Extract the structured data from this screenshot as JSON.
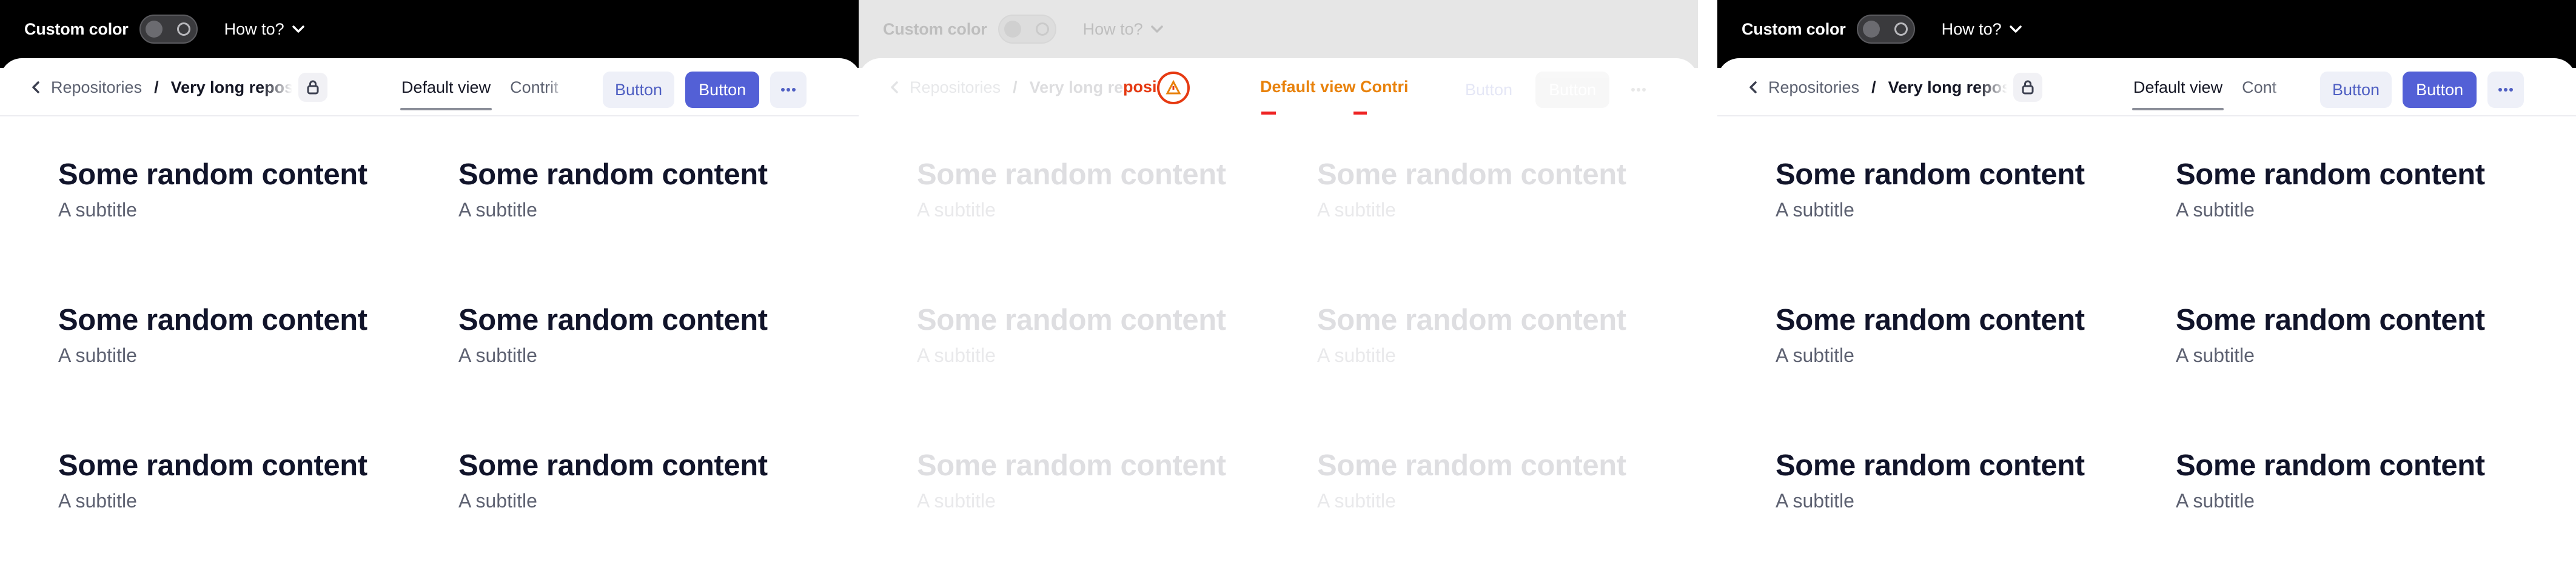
{
  "topbar": {
    "custom_color_label": "Custom color",
    "howto_label": "How to?"
  },
  "breadcrumb": {
    "back": "Repositories",
    "separator": "/",
    "current": "Very long repository name"
  },
  "tabs": {
    "default_view": "Default view",
    "contributors_truncated_1": "Contrit",
    "contributors_truncated_3": "Cont"
  },
  "actions": {
    "secondary_label": "Button",
    "primary_label": "Button"
  },
  "content": {
    "items": [
      {
        "title": "Some random content",
        "subtitle": "A subtitle"
      },
      {
        "title": "Some random content",
        "subtitle": "A subtitle"
      },
      {
        "title": "Some random content",
        "subtitle": "A subtitle"
      },
      {
        "title": "Some random content",
        "subtitle": "A subtitle"
      },
      {
        "title": "Some random content",
        "subtitle": "A subtitle"
      },
      {
        "title": "Some random content",
        "subtitle": "A subtitle"
      }
    ]
  },
  "overlay": {
    "glitch_fragment": "posi",
    "glitch_tabs_text": "Default view Contri"
  },
  "colors": {
    "accent": "#5360d6",
    "overlay_orange": "#e8820c",
    "overlay_red": "#e63a12",
    "topbar_dark": "#000000"
  }
}
